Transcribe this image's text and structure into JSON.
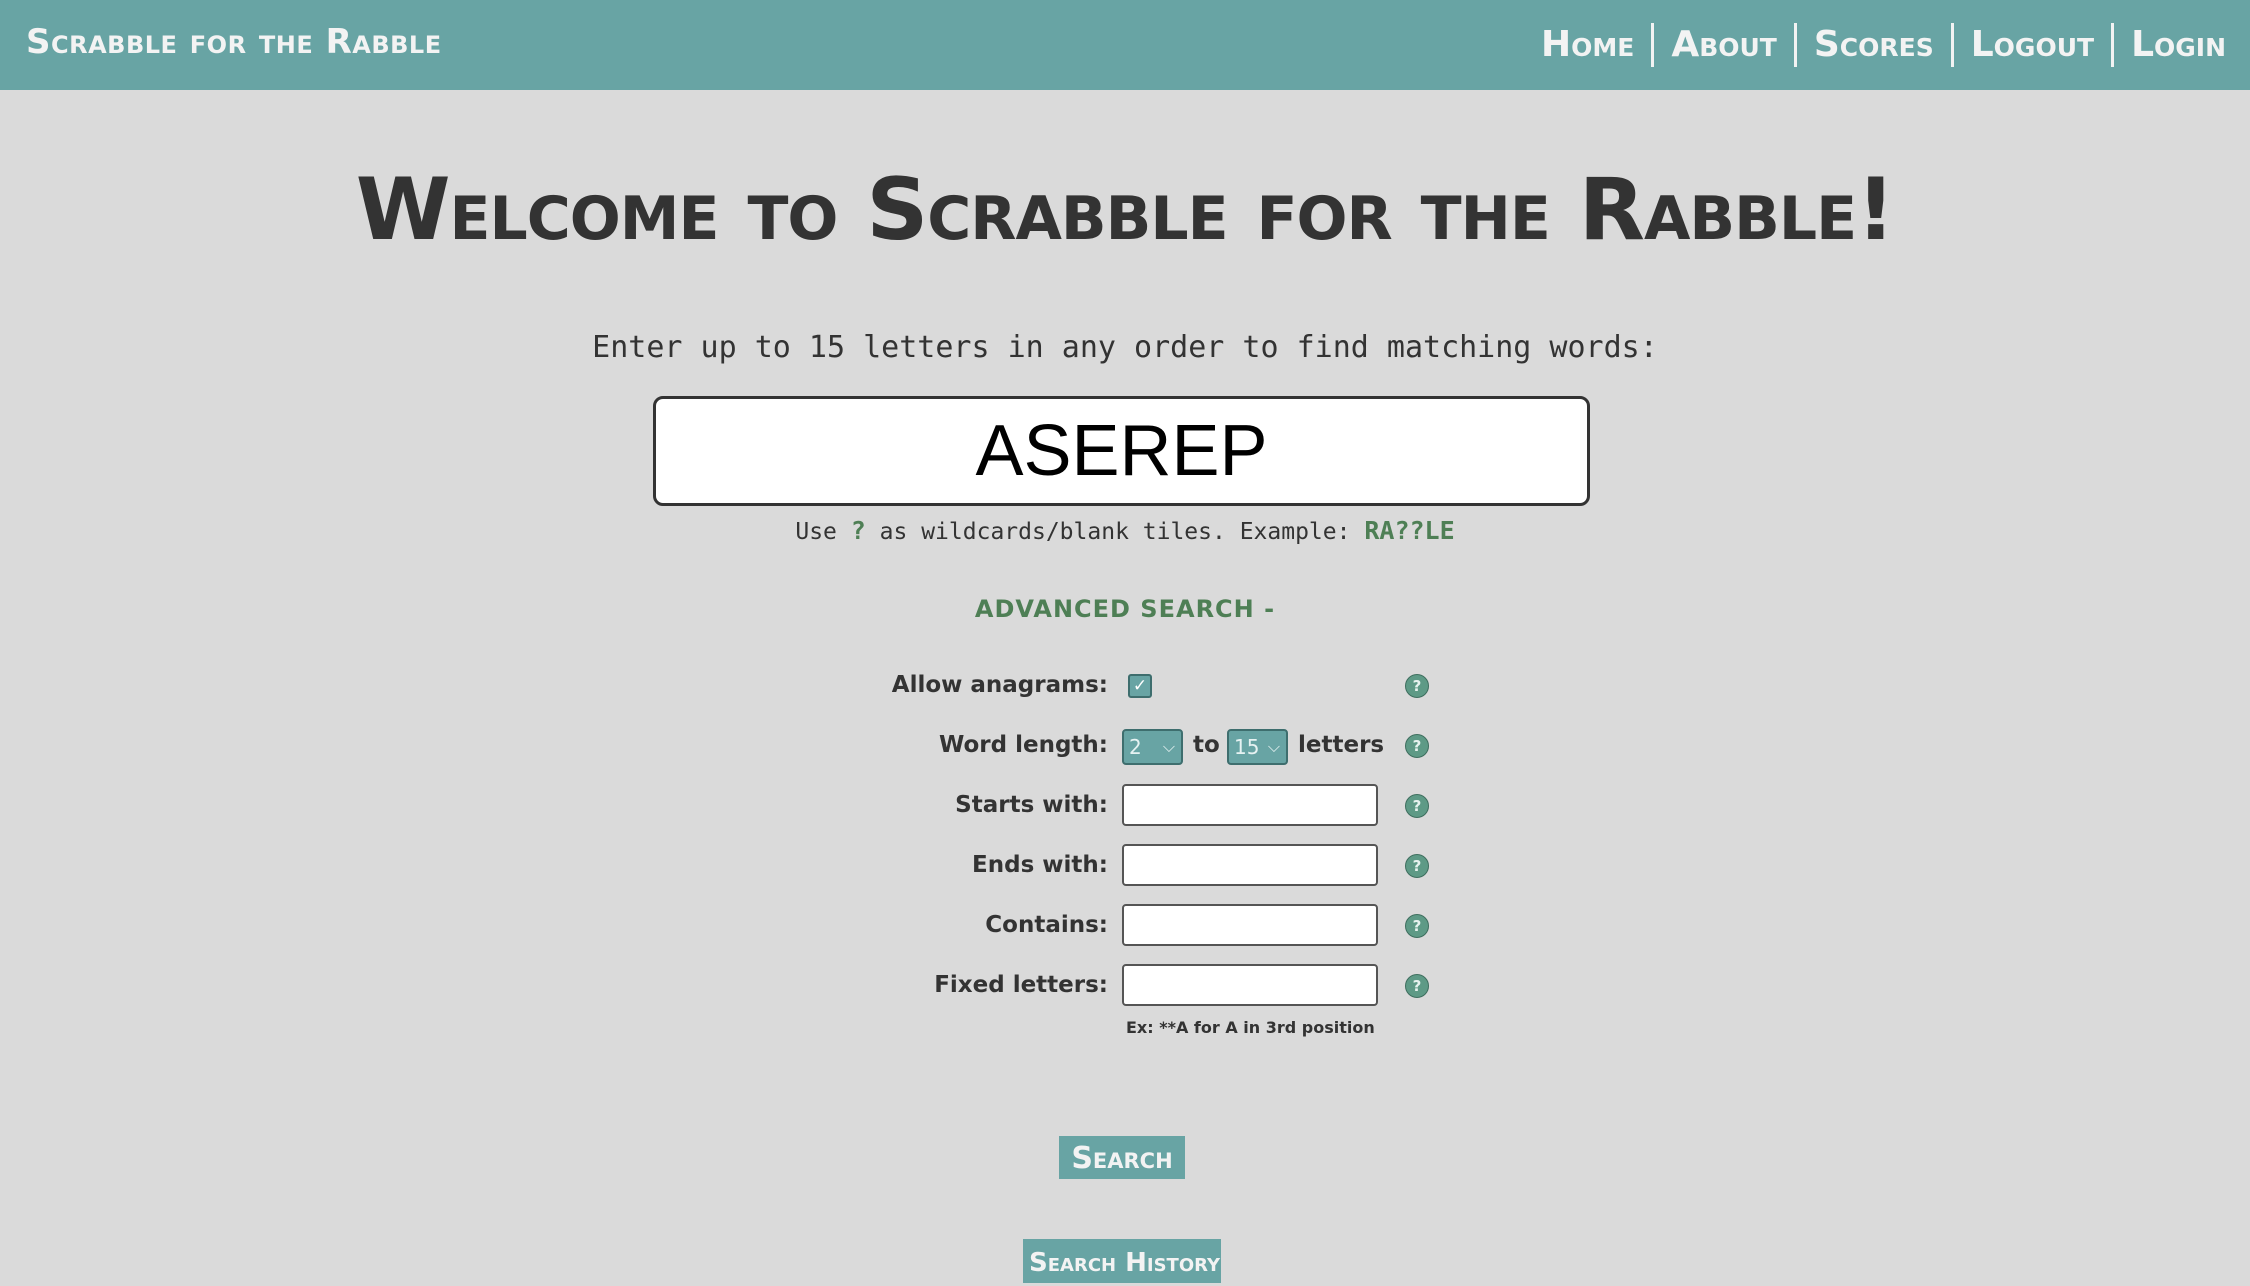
{
  "navbar": {
    "brand": "Scrabble for the Rabble",
    "links": [
      "Home",
      "About",
      "Scores",
      "Logout",
      "Login"
    ]
  },
  "main": {
    "title": "Welcome to Scrabble for the Rabble!",
    "instructions": "Enter up to 15 letters in any order to find matching words:",
    "letters_value": "ASEREP",
    "hint_prefix": "Use",
    "hint_wildcard": "?",
    "hint_middle": "as wildcards/blank tiles. Example:",
    "hint_example": "RA??LE",
    "advanced_toggle": "ADVANCED SEARCH -"
  },
  "advanced": {
    "anagrams_label": "Allow anagrams:",
    "anagrams_checked": true,
    "word_length_label": "Word length:",
    "min_length": "2",
    "to_text": "to",
    "max_length": "15",
    "letters_text": "letters",
    "starts_with_label": "Starts with:",
    "ends_with_label": "Ends with:",
    "contains_label": "Contains:",
    "fixed_letters_label": "Fixed letters:",
    "fixed_letters_hint": "Ex: **A for A in 3rd position",
    "help_glyph": "?"
  },
  "buttons": {
    "search": "Search",
    "history": "Search History"
  },
  "colors": {
    "navbar_bg": "#68a4a4",
    "page_bg": "#dadada",
    "accent_green": "#4e7f55"
  }
}
